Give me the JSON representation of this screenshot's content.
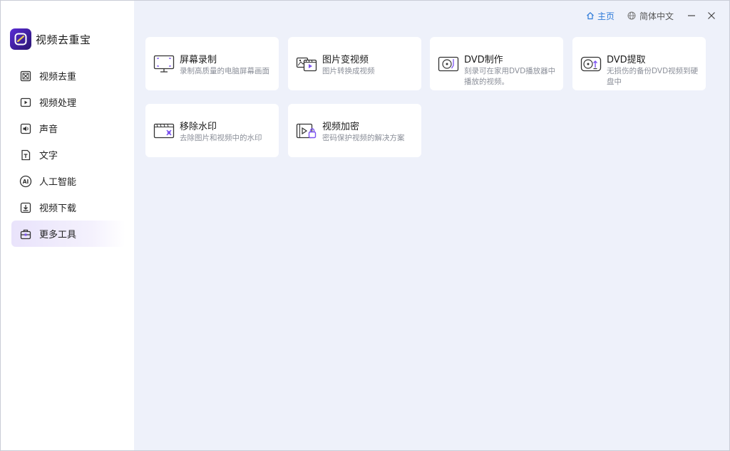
{
  "app": {
    "name": "视频去重宝"
  },
  "topbar": {
    "home_label": "主页",
    "language_label": "简体中文"
  },
  "sidebar": {
    "items": [
      {
        "label": "视频去重",
        "icon": "dedupe-icon"
      },
      {
        "label": "视频处理",
        "icon": "video-play-icon"
      },
      {
        "label": "声音",
        "icon": "audio-icon"
      },
      {
        "label": "文字",
        "icon": "text-icon"
      },
      {
        "label": "人工智能",
        "icon": "ai-icon"
      },
      {
        "label": "视频下载",
        "icon": "download-icon"
      },
      {
        "label": "更多工具",
        "icon": "toolbox-icon",
        "active": true
      }
    ]
  },
  "tools": [
    {
      "title": "屏幕录制",
      "desc": "录制高质量的电脑屏幕画面",
      "icon": "screen-record-icon"
    },
    {
      "title": "图片变视频",
      "desc": "图片转换成视频",
      "icon": "image-to-video-icon"
    },
    {
      "title": "DVD制作",
      "desc": "刻录可在家用DVD播放器中播放的视频。",
      "icon": "dvd-burn-icon"
    },
    {
      "title": "DVD提取",
      "desc": "无损伤的备份DVD视频到硬盘中",
      "icon": "dvd-extract-icon"
    },
    {
      "title": "移除水印",
      "desc": "去除图片和视频中的水印",
      "icon": "remove-watermark-icon"
    },
    {
      "title": "视频加密",
      "desc": "密码保护视频的解决方案",
      "icon": "video-encrypt-icon"
    }
  ],
  "colors": {
    "accent": "#6a3de8",
    "link": "#2e7bd9",
    "background": "#eef1fa",
    "card": "#ffffff",
    "muted_text": "#8b8f99"
  }
}
